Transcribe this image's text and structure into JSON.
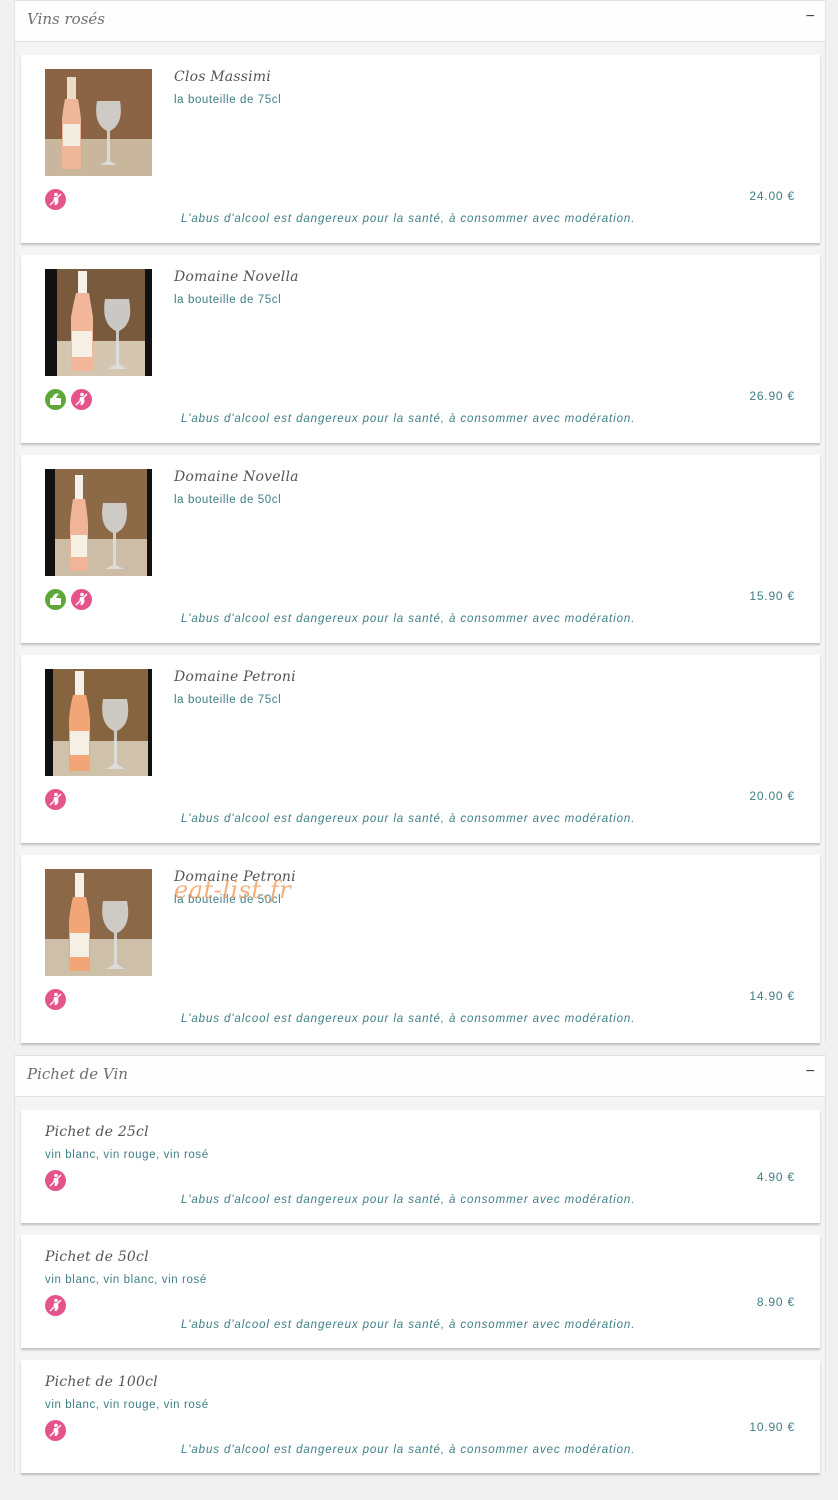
{
  "sections": [
    {
      "title": "Vins rosés",
      "toggle": "−",
      "items": [
        {
          "name": "Clos Massimi",
          "desc": "la bouteille de 75cl",
          "price": "24.00 €",
          "icons": [
            "no-pregnant-icon"
          ]
        },
        {
          "name": "Domaine Novella",
          "desc": "la bouteille de 75cl",
          "price": "26.90 €",
          "icons": [
            "organic-icon",
            "no-pregnant-icon"
          ]
        },
        {
          "name": "Domaine Novella",
          "desc": "la bouteille de 50cl",
          "price": "15.90 €",
          "icons": [
            "organic-icon",
            "no-pregnant-icon"
          ]
        },
        {
          "name": "Domaine Petroni",
          "desc": "la bouteille de 75cl",
          "price": "20.00 €",
          "icons": [
            "no-pregnant-icon"
          ]
        },
        {
          "name": "Domaine Petroni",
          "desc": "la bouteille de 50cl",
          "price": "14.90 €",
          "icons": [
            "no-pregnant-icon"
          ]
        }
      ]
    },
    {
      "title": "Pichet de Vin",
      "toggle": "−",
      "items": [
        {
          "name": "Pichet de 25cl",
          "desc": "vin blanc, vin rouge, vin rosé",
          "price": "4.90 €",
          "icons": [
            "no-pregnant-icon"
          ]
        },
        {
          "name": "Pichet de 50cl",
          "desc": "vin blanc, vin blanc, vin rosé",
          "price": "8.90 €",
          "icons": [
            "no-pregnant-icon"
          ]
        },
        {
          "name": "Pichet de 100cl",
          "desc": "vin blanc, vin rouge, vin rosé",
          "price": "10.90 €",
          "icons": [
            "no-pregnant-icon"
          ]
        }
      ]
    }
  ],
  "warning": "L'abus d'alcool est dangereux pour la santé, à consommer avec modération.",
  "watermark": "eat-list.fr",
  "colors": {
    "accent": "#3e7f86",
    "pink_icon": "#e4538a",
    "green_icon": "#5da73b"
  }
}
